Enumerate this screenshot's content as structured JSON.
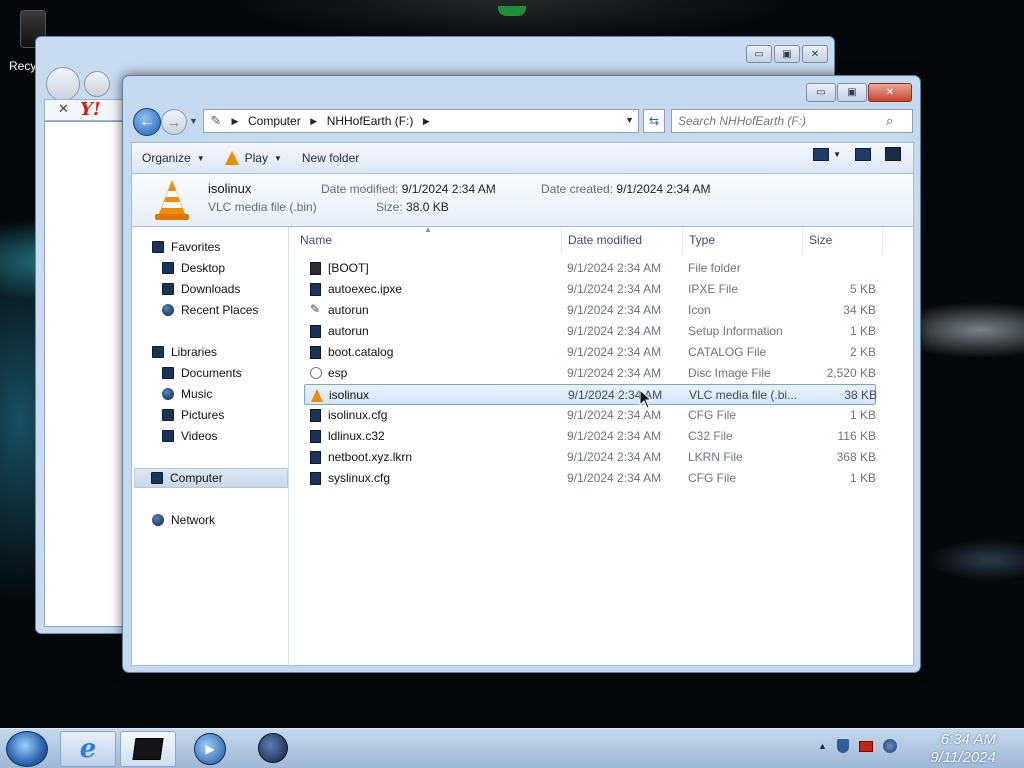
{
  "desktop": {
    "recycle_label": "Recy"
  },
  "ie_window": {
    "close_glyph": "✕",
    "yahoo_text": "Y!"
  },
  "explorer": {
    "caption_buttons": {
      "minimize": "▭",
      "maximize": "▣",
      "close": "✕"
    },
    "address": {
      "crumbs": [
        "Computer",
        "NHHofEarth (F:)"
      ]
    },
    "search": {
      "placeholder": "Search NHHofEarth (F:)"
    },
    "commands": {
      "organize": "Organize",
      "play": "Play",
      "new_folder": "New folder"
    },
    "details": {
      "name": "isolinux",
      "type": "VLC media file (.bin)",
      "date_modified_label": "Date modified:",
      "date_modified": "9/1/2024 2:34 AM",
      "date_created_label": "Date created:",
      "date_created": "9/1/2024 2:34 AM",
      "size_label": "Size:",
      "size": "38.0 KB"
    },
    "nav": {
      "favorites": "Favorites",
      "desktop": "Desktop",
      "downloads": "Downloads",
      "recent_places": "Recent Places",
      "libraries": "Libraries",
      "documents": "Documents",
      "music": "Music",
      "pictures": "Pictures",
      "videos": "Videos",
      "computer": "Computer",
      "network": "Network"
    },
    "columns": {
      "name": "Name",
      "date_modified": "Date modified",
      "type": "Type",
      "size": "Size"
    },
    "files": [
      {
        "name": "[BOOT]",
        "date": "9/1/2024 2:34 AM",
        "type": "File folder",
        "size": ""
      },
      {
        "name": "autoexec.ipxe",
        "date": "9/1/2024 2:34 AM",
        "type": "IPXE File",
        "size": "5 KB"
      },
      {
        "name": "autorun",
        "date": "9/1/2024 2:34 AM",
        "type": "Icon",
        "size": "34 KB"
      },
      {
        "name": "autorun",
        "date": "9/1/2024 2:34 AM",
        "type": "Setup Information",
        "size": "1 KB"
      },
      {
        "name": "boot.catalog",
        "date": "9/1/2024 2:34 AM",
        "type": "CATALOG File",
        "size": "2 KB"
      },
      {
        "name": "esp",
        "date": "9/1/2024 2:34 AM",
        "type": "Disc Image File",
        "size": "2,520 KB"
      },
      {
        "name": "isolinux",
        "date": "9/1/2024 2:34 AM",
        "type": "VLC media file (.bi...",
        "size": "38 KB"
      },
      {
        "name": "isolinux.cfg",
        "date": "9/1/2024 2:34 AM",
        "type": "CFG File",
        "size": "1 KB"
      },
      {
        "name": "ldlinux.c32",
        "date": "9/1/2024 2:34 AM",
        "type": "C32 File",
        "size": "116 KB"
      },
      {
        "name": "netboot.xyz.lkrn",
        "date": "9/1/2024 2:34 AM",
        "type": "LKRN File",
        "size": "368 KB"
      },
      {
        "name": "syslinux.cfg",
        "date": "9/1/2024 2:34 AM",
        "type": "CFG File",
        "size": "1 KB"
      }
    ]
  },
  "taskbar": {
    "time": "6:34 AM",
    "date": "9/11/2024"
  }
}
